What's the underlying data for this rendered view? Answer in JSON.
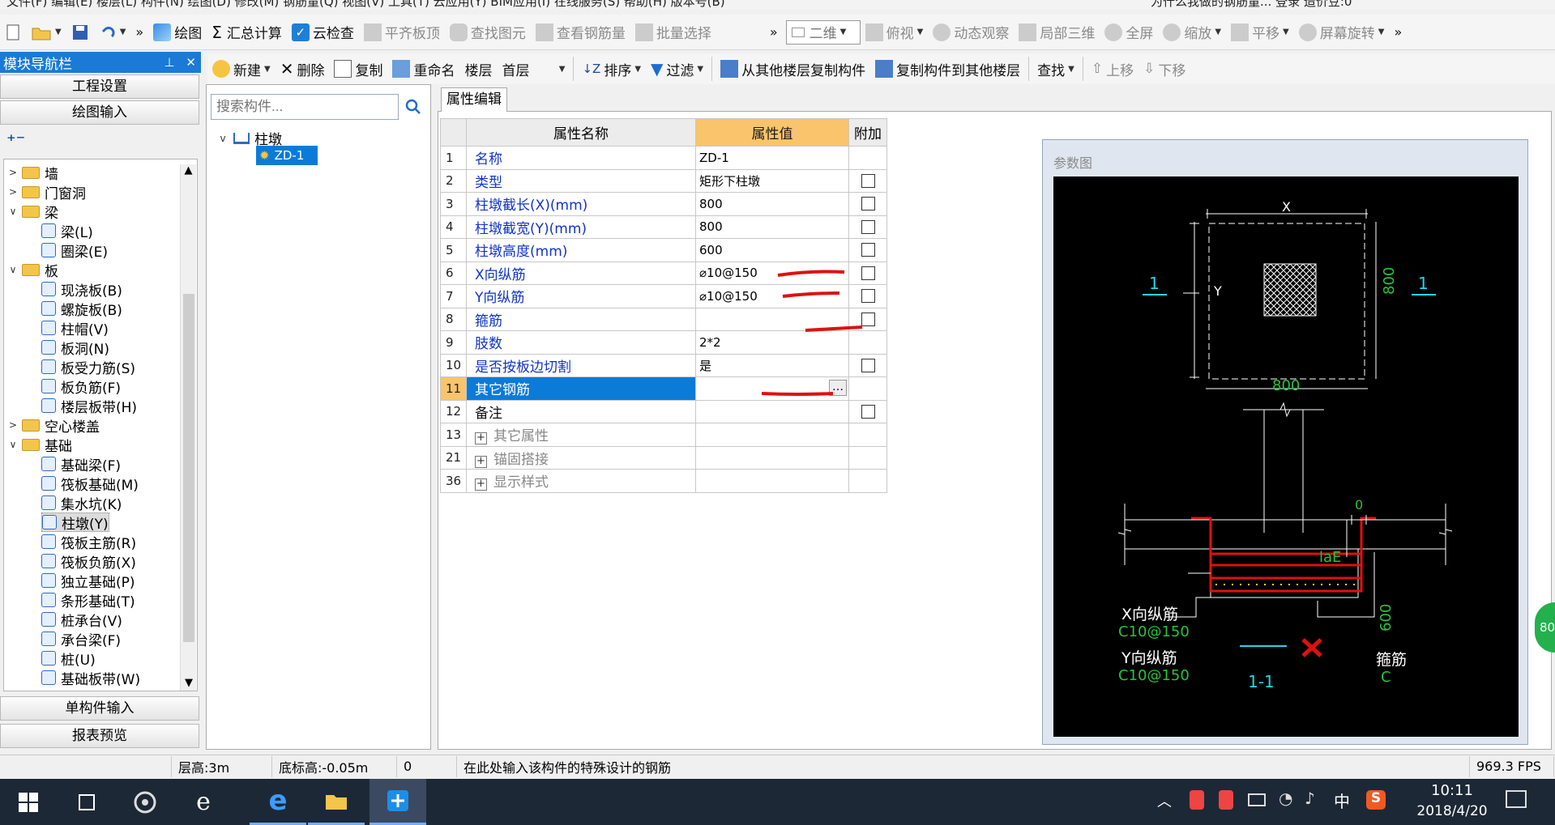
{
  "menu": {
    "left_fragment": "文件(F) 编辑(E) 楼层(L) 构件(N) 绘图(D) 修改(M) 钢筋量(Q) 视图(V) 工具(T) 云应用(Y) BIM应用(I) 在线服务(S) 帮助(H) 版本号(B)",
    "right_fragment": "为什么我做的钢筋量... 登录 造价豆:0"
  },
  "toolbar1": {
    "draw": "绘图",
    "sum": "汇总计算",
    "cloud_check": "云检查",
    "flat_top": "平齐板顶",
    "find_elem": "查找图元",
    "view_rebar": "查看钢筋量",
    "batch_select": "批量选择",
    "view_mode": "二维",
    "top_view": "俯视",
    "dynamic": "动态观察",
    "local3d": "局部三维",
    "fullscreen": "全屏",
    "zoom": "缩放",
    "pan": "平移",
    "rotate": "屏幕旋转"
  },
  "nav": {
    "title": "模块导航栏",
    "btn_project": "工程设置",
    "btn_draw": "绘图输入",
    "btn_single": "单构件输入",
    "btn_report": "报表预览",
    "tree": [
      {
        "label": "墙",
        "level": 0,
        "toggle": ">",
        "type": "folder"
      },
      {
        "label": "门窗洞",
        "level": 0,
        "toggle": ">",
        "type": "folder"
      },
      {
        "label": "梁",
        "level": 0,
        "toggle": "v",
        "type": "folder"
      },
      {
        "label": "梁(L)",
        "level": 1,
        "type": "leaf"
      },
      {
        "label": "圈梁(E)",
        "level": 1,
        "type": "leaf"
      },
      {
        "label": "板",
        "level": 0,
        "toggle": "v",
        "type": "folder"
      },
      {
        "label": "现浇板(B)",
        "level": 1,
        "type": "leaf"
      },
      {
        "label": "螺旋板(B)",
        "level": 1,
        "type": "leaf"
      },
      {
        "label": "柱帽(V)",
        "level": 1,
        "type": "leaf"
      },
      {
        "label": "板洞(N)",
        "level": 1,
        "type": "leaf"
      },
      {
        "label": "板受力筋(S)",
        "level": 1,
        "type": "leaf"
      },
      {
        "label": "板负筋(F)",
        "level": 1,
        "type": "leaf"
      },
      {
        "label": "楼层板带(H)",
        "level": 1,
        "type": "leaf"
      },
      {
        "label": "空心楼盖",
        "level": 0,
        "toggle": ">",
        "type": "folder"
      },
      {
        "label": "基础",
        "level": 0,
        "toggle": "v",
        "type": "folder"
      },
      {
        "label": "基础梁(F)",
        "level": 1,
        "type": "leaf"
      },
      {
        "label": "筏板基础(M)",
        "level": 1,
        "type": "leaf"
      },
      {
        "label": "集水坑(K)",
        "level": 1,
        "type": "leaf"
      },
      {
        "label": "柱墩(Y)",
        "level": 1,
        "type": "leaf",
        "selected": true
      },
      {
        "label": "筏板主筋(R)",
        "level": 1,
        "type": "leaf"
      },
      {
        "label": "筏板负筋(X)",
        "level": 1,
        "type": "leaf"
      },
      {
        "label": "独立基础(P)",
        "level": 1,
        "type": "leaf"
      },
      {
        "label": "条形基础(T)",
        "level": 1,
        "type": "leaf"
      },
      {
        "label": "桩承台(V)",
        "level": 1,
        "type": "leaf"
      },
      {
        "label": "承台梁(F)",
        "level": 1,
        "type": "leaf"
      },
      {
        "label": "桩(U)",
        "level": 1,
        "type": "leaf"
      },
      {
        "label": "基础板带(W)",
        "level": 1,
        "type": "leaf"
      }
    ]
  },
  "toolbar2": {
    "new": "新建",
    "delete": "删除",
    "copy": "复制",
    "rename": "重命名",
    "floor_label": "楼层",
    "floor_value": "首层",
    "sort": "排序",
    "filter": "过滤",
    "copy_from": "从其他楼层复制构件",
    "copy_to": "复制构件到其他楼层",
    "find": "查找",
    "up": "上移",
    "down": "下移"
  },
  "search": {
    "placeholder": "搜索构件..."
  },
  "comp_tree": {
    "parent": "柱墩",
    "child": "ZD-1"
  },
  "props": {
    "tab": "属性编辑",
    "headers": {
      "num": "",
      "name": "属性名称",
      "value": "属性值",
      "add": "附加"
    },
    "rows": [
      {
        "num": "1",
        "name": "名称",
        "value": "ZD-1",
        "check": false
      },
      {
        "num": "2",
        "name": "类型",
        "value": "矩形下柱墩",
        "check": true
      },
      {
        "num": "3",
        "name": "柱墩截长(X)(mm)",
        "value": "800",
        "check": true
      },
      {
        "num": "4",
        "name": "柱墩截宽(Y)(mm)",
        "value": "800",
        "check": true
      },
      {
        "num": "5",
        "name": "柱墩高度(mm)",
        "value": "600",
        "check": true
      },
      {
        "num": "6",
        "name": "X向纵筋",
        "value": "⌀10@150",
        "check": true
      },
      {
        "num": "7",
        "name": "Y向纵筋",
        "value": "⌀10@150",
        "check": true
      },
      {
        "num": "8",
        "name": "箍筋",
        "value": "",
        "check": true
      },
      {
        "num": "9",
        "name": "肢数",
        "value": "2*2",
        "check": false
      },
      {
        "num": "10",
        "name": "是否按板边切割",
        "value": "是",
        "check": true
      },
      {
        "num": "11",
        "name": "其它钢筋",
        "value": "",
        "check": false
      },
      {
        "num": "12",
        "name": "备注",
        "value": "",
        "check": true
      },
      {
        "num": "13",
        "name": "其它属性",
        "value": "",
        "check": false
      },
      {
        "num": "21",
        "name": "锚固搭接",
        "value": "",
        "check": false
      },
      {
        "num": "36",
        "name": "显示样式",
        "value": "",
        "check": false
      }
    ]
  },
  "diagram": {
    "label": "参数图",
    "dim_x": "X",
    "dim_y": "Y",
    "dim_800_h": "800",
    "dim_800_v": "800",
    "sec_left": "1",
    "sec_right": "1",
    "dim_0": "0",
    "lae": "laE",
    "dim_600": "600",
    "x_rebar": "X向纵筋",
    "x_rebar_val": "C10@150",
    "y_rebar": "Y向纵筋",
    "y_rebar_val": "C10@150",
    "stirrup": "箍筋",
    "stirrup_val": "C",
    "section": "1-1"
  },
  "statusbar": {
    "floor_height": "层高:3m",
    "base_elev": "底标高:-0.05m",
    "zero": "0",
    "hint": "在此处输入该构件的特殊设计的钢筋",
    "fps": "969.3 FPS"
  },
  "taskbar": {
    "time": "10:11",
    "date": "2018/4/20",
    "ime": "中"
  },
  "side_badge": "80",
  "colors": {
    "nav_header": "#1a7ad6",
    "header_value": "#f9c46b",
    "selection": "#0b7bd8",
    "prop_name": "#1033cc",
    "diagram_bg": "#000000",
    "rebar_red": "#e01010",
    "dim_green": "#27c33a",
    "label_cyan": "#1fd8e8"
  }
}
